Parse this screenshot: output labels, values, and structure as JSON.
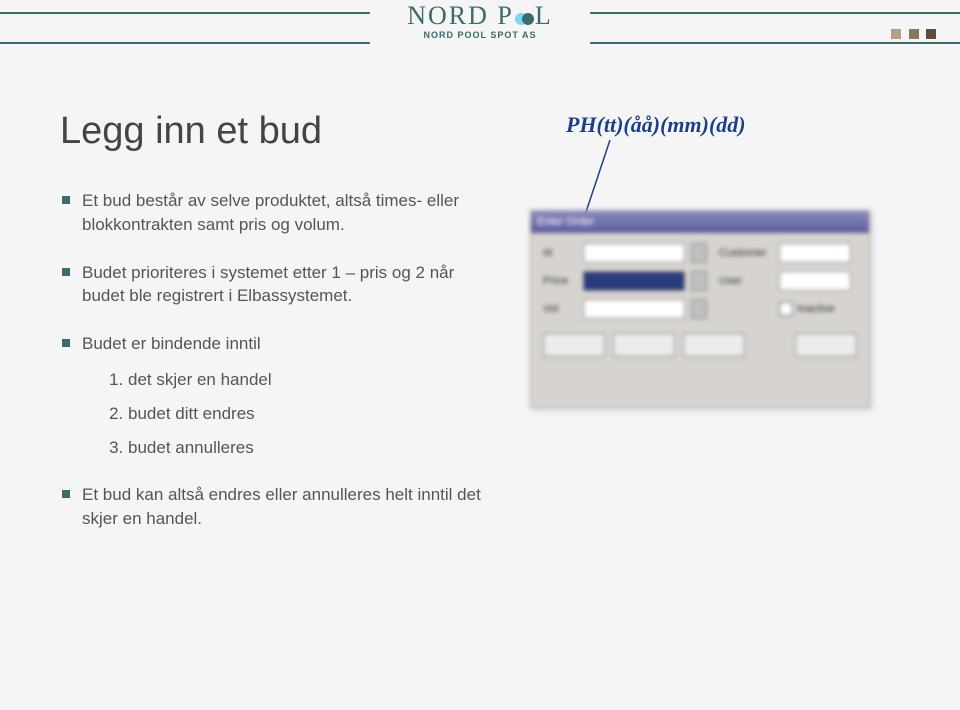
{
  "logo": {
    "main_left": "NORD P",
    "main_right": "L",
    "sub": "NORD POOL SPOT AS"
  },
  "title": "Legg inn et bud",
  "bullets": [
    "Et bud består av selve produktet, altså times- eller blokkontrakten samt pris og volum.",
    "Budet prioriteres i systemet etter 1 – pris og 2 når budet ble registrert i Elbassystemet.",
    "Budet er bindende inntil",
    "Et bud kan altså endres eller annulleres helt inntil det skjer en handel."
  ],
  "sublist": [
    "det skjer en handel",
    "budet ditt endres",
    "budet annulleres"
  ],
  "annotation": "PH(tt)(åå)(mm)(dd)",
  "panel": {
    "title": "Enter Order",
    "labels": {
      "id": "Id",
      "price": "Price",
      "vol": "Vol",
      "customer": "Customer",
      "user": "User",
      "checkbox": "Inactive"
    }
  }
}
